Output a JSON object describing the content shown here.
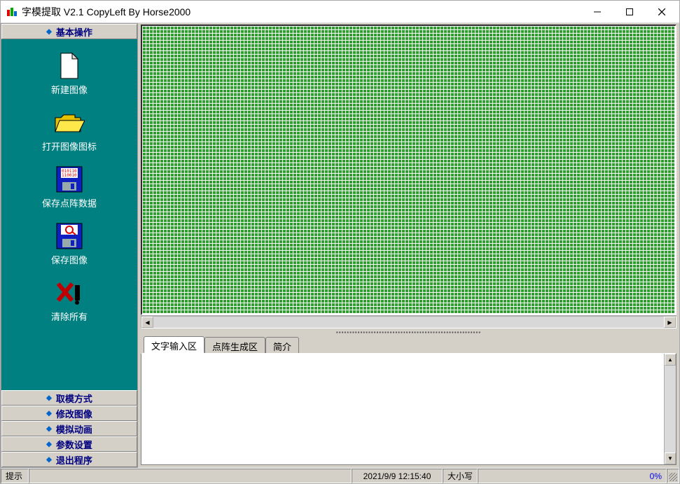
{
  "window": {
    "title": "字模提取 V2.1  CopyLeft By Horse2000"
  },
  "sidebar": {
    "header": "基本操作",
    "items": [
      {
        "label": "新建图像"
      },
      {
        "label": "打开图像图标"
      },
      {
        "label": "保存点阵数据"
      },
      {
        "label": "保存图像"
      },
      {
        "label": "清除所有"
      }
    ],
    "bottom": [
      {
        "label": "取模方式"
      },
      {
        "label": "修改图像"
      },
      {
        "label": "模拟动画"
      },
      {
        "label": "参数设置"
      },
      {
        "label": "退出程序"
      }
    ]
  },
  "tabs": [
    {
      "label": "文字输入区"
    },
    {
      "label": "点阵生成区"
    },
    {
      "label": "简介"
    }
  ],
  "status": {
    "hint_label": "提示",
    "datetime": "2021/9/9 12:15:40",
    "caps": "大小写",
    "percent": "0%"
  },
  "colors": {
    "teal": "#008080",
    "blue": "#0000cc",
    "yellow": "#ffde00",
    "red": "#d00000"
  }
}
